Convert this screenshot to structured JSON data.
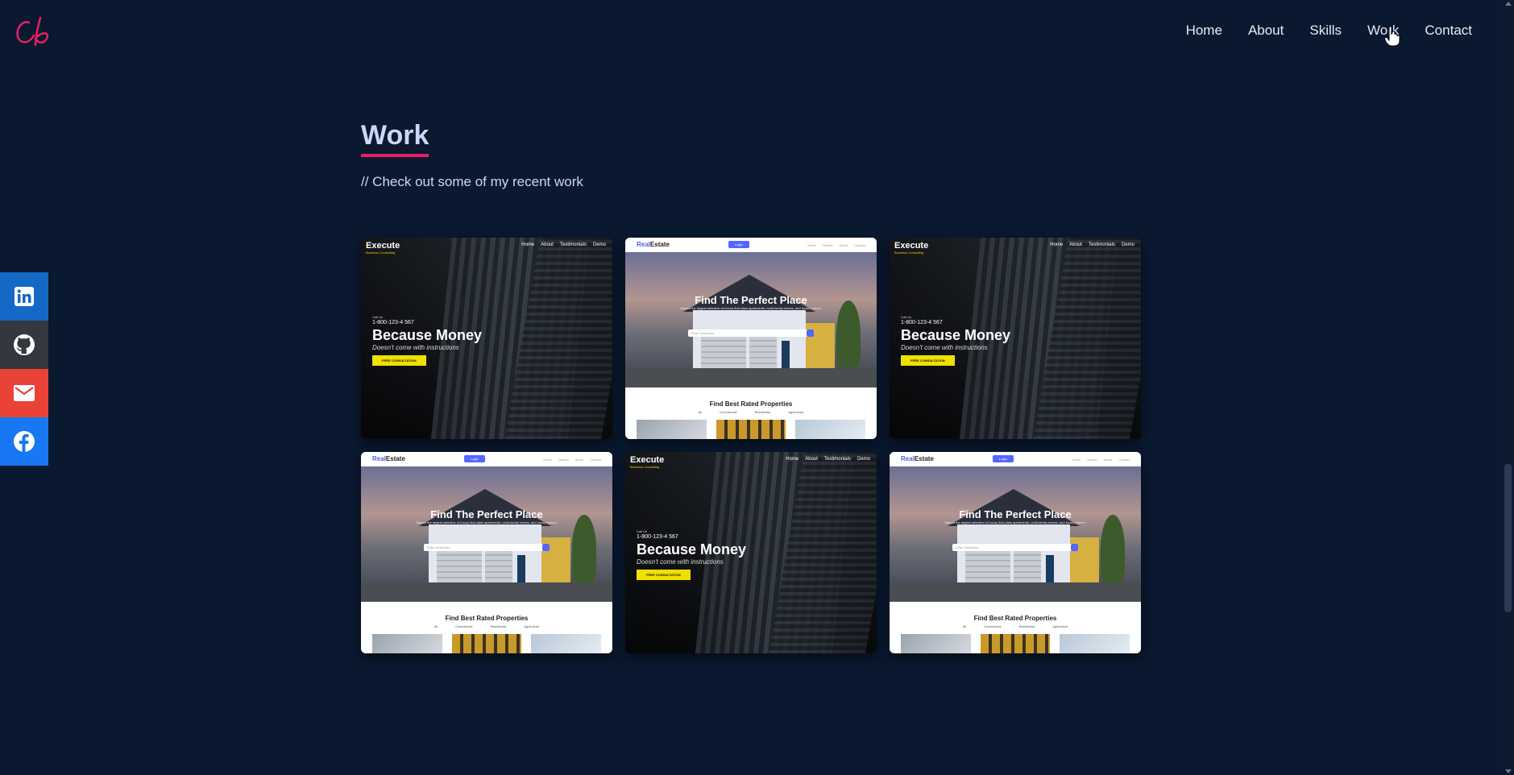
{
  "header": {
    "logo_text": "Cb",
    "nav": [
      "Home",
      "About",
      "Skills",
      "Work",
      "Contact"
    ]
  },
  "section": {
    "title": "Work",
    "subtitle": "// Check out some of my recent work"
  },
  "social": [
    "linkedin-icon",
    "github-icon",
    "mail-icon",
    "facebook-icon"
  ],
  "projects": {
    "execute": {
      "brand": "Execute",
      "brand_sub": "Business Consulting",
      "nav": [
        "Home",
        "About",
        "Testimonials",
        "Demo"
      ],
      "call_label": "Call Us",
      "phone": "1-800-123-4 567",
      "headline": "Because Money",
      "subline": "Doesn't come with instructions",
      "button": "FREE CONSULTATION"
    },
    "realestate": {
      "brand_a": "Real",
      "brand_b": "Estate",
      "login": "Login",
      "nav": [
        "Home",
        "Search",
        "About",
        "Contact"
      ],
      "headline": "Find The Perfect Place",
      "subline": "Search the largest selection of luxury first-class apartments, multi-family homes, and luxury homes.",
      "search_placeholder": "Enter Keywords",
      "best_title": "Find Best Rated Properties",
      "tabs": [
        "All",
        "Commercial",
        "Residential",
        "Agriculture"
      ]
    }
  },
  "colors": {
    "background": "#0a192f",
    "accent": "#e91e63",
    "text": "#ccd6f6",
    "linkedin": "#1569c6",
    "github": "#333840",
    "mail": "#ea4335",
    "facebook": "#1877f2"
  }
}
